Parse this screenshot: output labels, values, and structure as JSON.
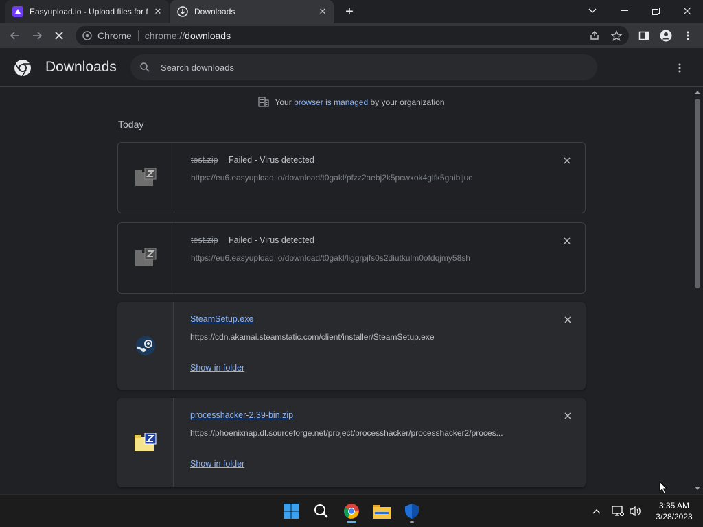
{
  "tabs": [
    {
      "title": "Easyupload.io - Upload files for free",
      "active": false
    },
    {
      "title": "Downloads",
      "active": true
    }
  ],
  "omnibox": {
    "scheme_label": "Chrome",
    "url_prefix": "chrome://",
    "url_path": "downloads"
  },
  "page": {
    "title": "Downloads",
    "search_placeholder": "Search downloads",
    "managed": {
      "prefix": "Your ",
      "link": "browser is managed",
      "suffix": " by your organization"
    },
    "section_label": "Today"
  },
  "downloads": [
    {
      "name": "test.zip",
      "status": "Failed - Virus detected",
      "url": "https://eu6.easyupload.io/download/t0gakl/pfzz2aebj2k5pcwxok4glfk5gaibljuc",
      "state": "failed",
      "icon": "zip-file-icon"
    },
    {
      "name": "test.zip",
      "status": "Failed - Virus detected",
      "url": "https://eu6.easyupload.io/download/t0gakl/liggrpjfs0s2diutkulm0ofdqjmy58sh",
      "state": "failed",
      "icon": "zip-file-icon"
    },
    {
      "name": "SteamSetup.exe",
      "url": "https://cdn.akamai.steamstatic.com/client/installer/SteamSetup.exe",
      "action": "Show in folder",
      "state": "complete",
      "icon": "steam-icon"
    },
    {
      "name": "processhacker-2.39-bin.zip",
      "url": "https://phoenixnap.dl.sourceforge.net/project/processhacker/processhacker2/proces...",
      "action": "Show in folder",
      "state": "complete",
      "icon": "zip-folder-icon"
    }
  ],
  "clock": {
    "time": "3:35 AM",
    "date": "3/28/2023"
  },
  "colors": {
    "accent": "#8ab4f8",
    "background": "#202124",
    "toolbar": "#35363a"
  }
}
